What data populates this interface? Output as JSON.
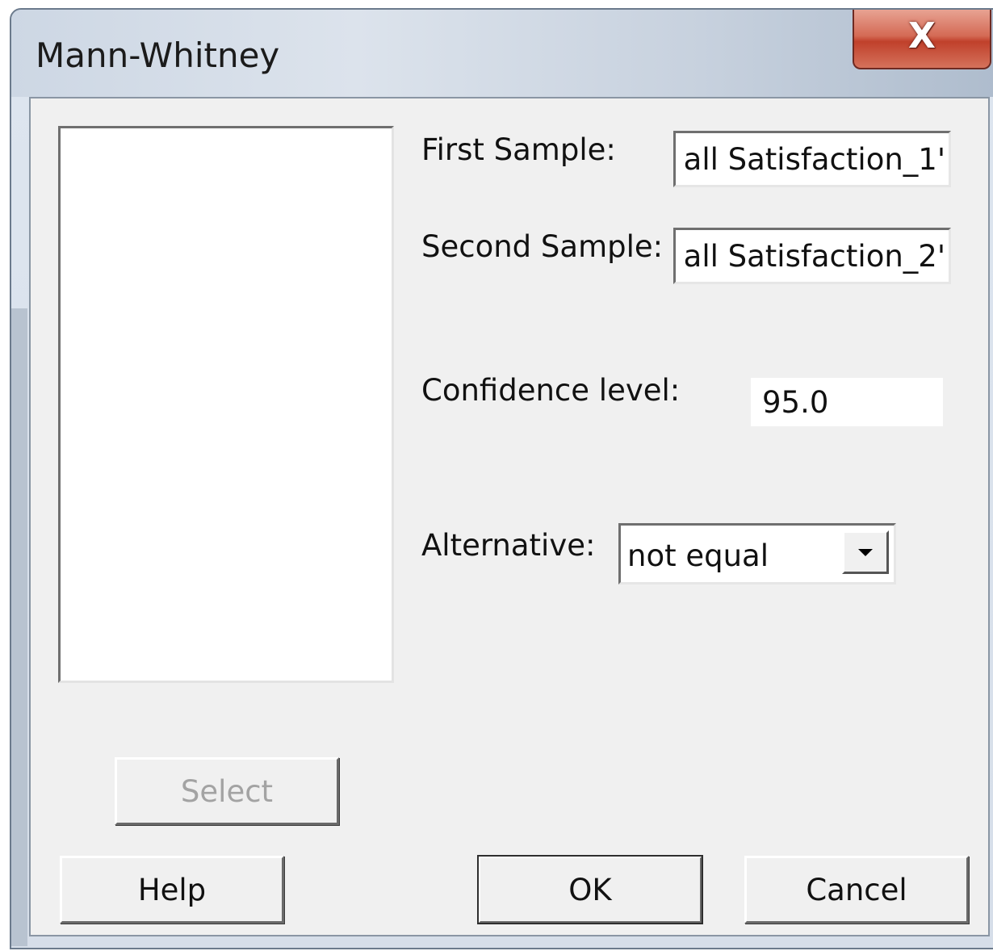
{
  "window": {
    "title": "Mann-Whitney",
    "close_label": "X"
  },
  "form": {
    "first_sample": {
      "label": "First Sample:",
      "value": "all Satisfaction_1'"
    },
    "second_sample": {
      "label": "Second Sample:",
      "value": "all Satisfaction_2'"
    },
    "confidence_level": {
      "label": "Confidence level:",
      "value": "95.0"
    },
    "alternative": {
      "label": "Alternative:",
      "selected": "not equal"
    }
  },
  "buttons": {
    "select": "Select",
    "help": "Help",
    "ok": "OK",
    "cancel": "Cancel"
  },
  "icons": {
    "close": "close-icon",
    "dropdown": "chevron-down-icon"
  }
}
